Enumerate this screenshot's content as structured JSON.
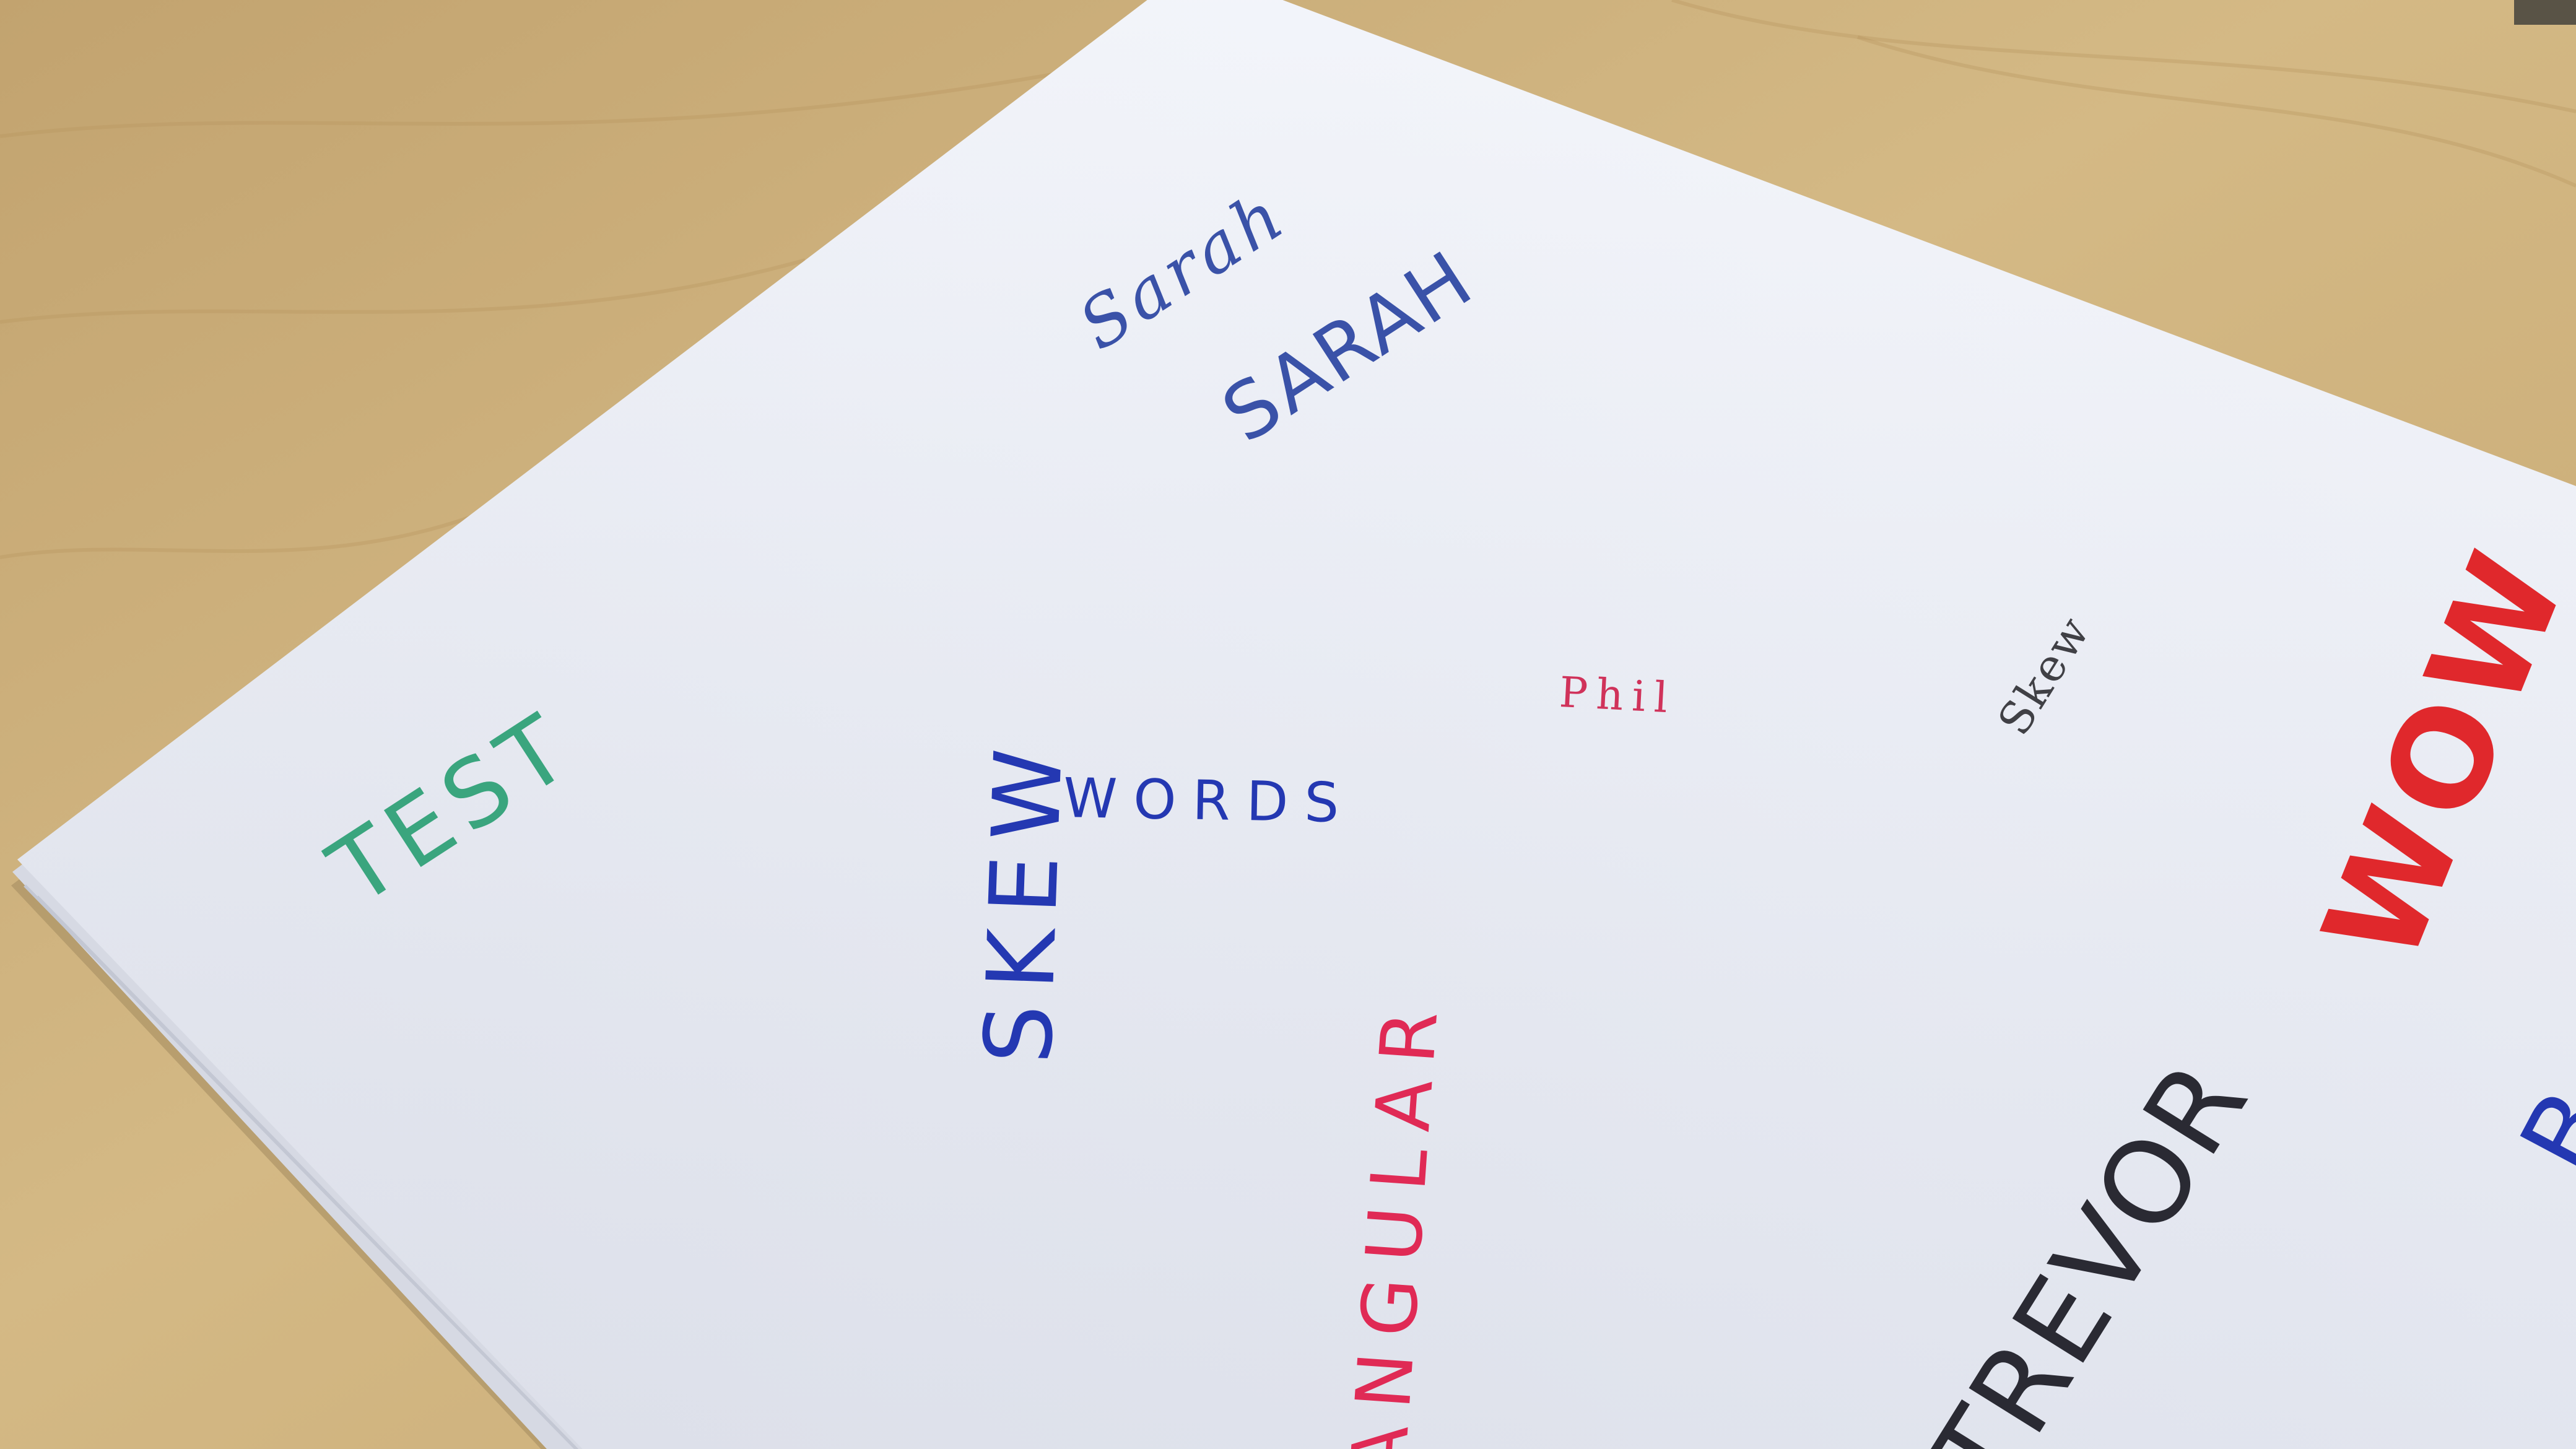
{
  "handwritten_words": [
    {
      "text": "TEST",
      "color": "#3aa57e"
    },
    {
      "text": "Sarah",
      "color": "#3a52a8"
    },
    {
      "text": "SARAH",
      "color": "#3a52a8"
    },
    {
      "text": "SKEW",
      "color": "#2438b2"
    },
    {
      "text": "WORDS",
      "color": "#2438b2"
    },
    {
      "text": "Phil",
      "color": "#d0325a"
    },
    {
      "text": "Skew",
      "color": "#404045"
    },
    {
      "text": "WOW",
      "color": "#e0282c"
    },
    {
      "text": "ANGULAR",
      "color": "#e02a55"
    },
    {
      "text": "TREVOR",
      "color": "#2a2a33"
    },
    {
      "text": "B",
      "color": "#2438b2"
    }
  ],
  "colors": {
    "desk": "#c9ac78",
    "paper": "#eaedf6"
  }
}
